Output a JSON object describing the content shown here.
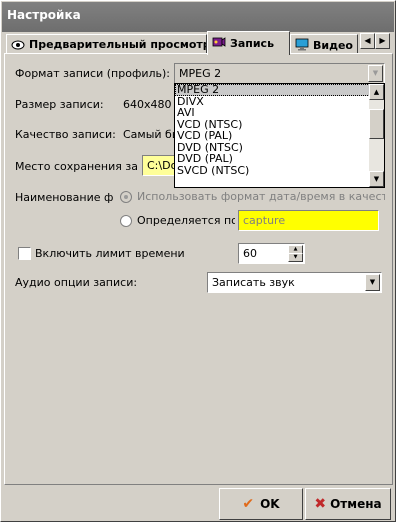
{
  "window": {
    "title": "Настройка"
  },
  "tabs": [
    {
      "label": "Предварительный просмотр",
      "icon": "eye-icon"
    },
    {
      "label": "Запись",
      "icon": "record-icon"
    },
    {
      "label": "Видео",
      "icon": "monitor-icon"
    }
  ],
  "form": {
    "format_label": "Формат записи (профиль):",
    "format_value": "MPEG 2",
    "format_options": [
      "MPEG 2",
      "DIVX",
      "AVI",
      "VCD (NTSC)",
      "VCD (PAL)",
      "DVD (NTSC)",
      "DVD (PAL)",
      "SVCD (NTSC)"
    ],
    "size_label": "Размер записи:",
    "size_value": "640x480",
    "quality_label": "Качество записи:",
    "quality_value": "Самый бы",
    "location_label": "Место сохранения запи",
    "location_value": "C:\\Do",
    "naming_label": "Наименование фай",
    "naming_option_datetime": "Использовать формат дата/время в качестве н",
    "naming_option_user": "Определяется поль",
    "naming_user_value": "capture",
    "time_limit_label": "Включить лимит времени",
    "time_limit_value": "60",
    "audio_label": "Аудио опции записи:",
    "audio_value": "Записать звук"
  },
  "buttons": {
    "ok_label": "OK",
    "cancel_label": "Отмена"
  },
  "colors": {
    "title_bg": "#7a7a7a",
    "window_bg": "#d4d0c8",
    "input_highlight": "#ffff00",
    "ok_check": "#e06a1a",
    "cancel_x": "#c0282a"
  }
}
